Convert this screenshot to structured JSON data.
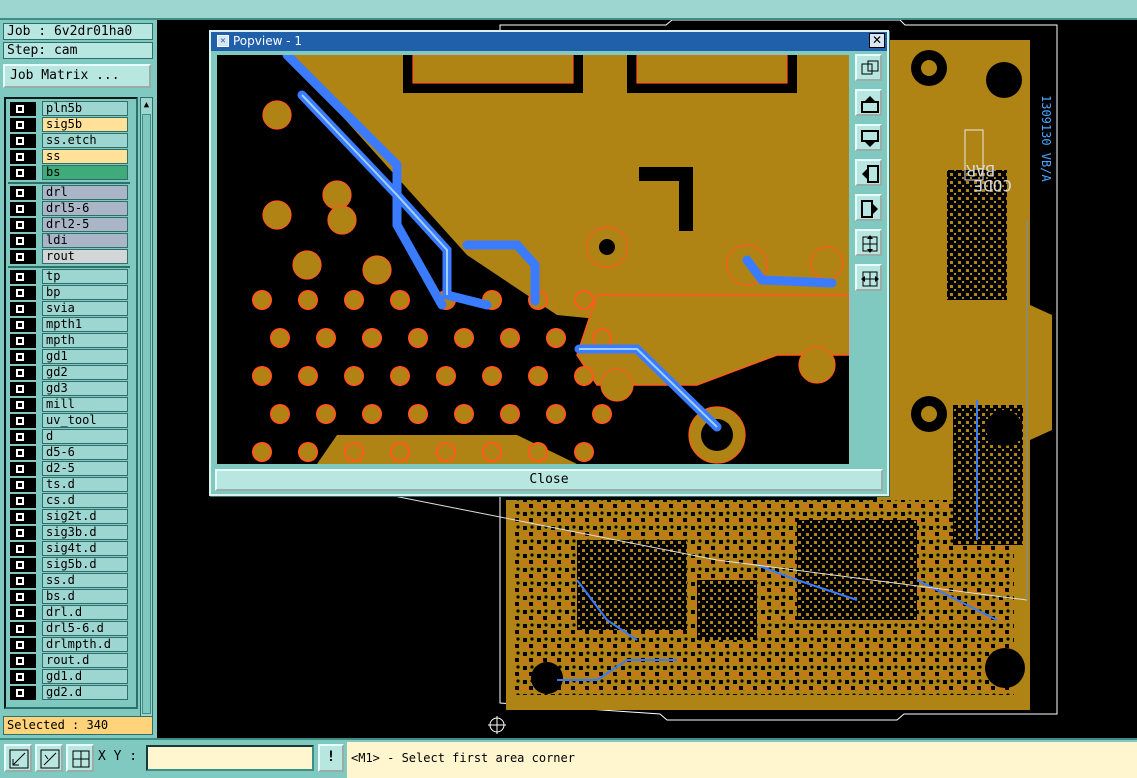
{
  "info": {
    "job_line": "Job : 6v2dr01ha0",
    "step_line": "Step: cam",
    "job_matrix_label": "Job Matrix ..."
  },
  "layers": [
    {
      "name": "pln5b",
      "style": "normal"
    },
    {
      "name": "sig5b",
      "style": "board"
    },
    {
      "name": "ss.etch",
      "style": "normal"
    },
    {
      "name": "ss",
      "style": "board",
      "active": true
    },
    {
      "name": "bs",
      "style": "bs"
    },
    {
      "name": "drl",
      "style": "drill"
    },
    {
      "name": "drl5-6",
      "style": "drill"
    },
    {
      "name": "drl2-5",
      "style": "drill"
    },
    {
      "name": "ldi",
      "style": "drill"
    },
    {
      "name": "rout",
      "style": "rout"
    },
    {
      "name": "tp",
      "style": "normal"
    },
    {
      "name": "bp",
      "style": "normal"
    },
    {
      "name": "svia",
      "style": "normal"
    },
    {
      "name": "mpth1",
      "style": "normal"
    },
    {
      "name": "mpth",
      "style": "normal"
    },
    {
      "name": "gd1",
      "style": "normal"
    },
    {
      "name": "gd2",
      "style": "normal"
    },
    {
      "name": "gd3",
      "style": "normal"
    },
    {
      "name": "mill",
      "style": "normal"
    },
    {
      "name": "uv_tool",
      "style": "normal"
    },
    {
      "name": "d",
      "style": "normal"
    },
    {
      "name": "d5-6",
      "style": "normal"
    },
    {
      "name": "d2-5",
      "style": "normal"
    },
    {
      "name": "ts.d",
      "style": "normal"
    },
    {
      "name": "cs.d",
      "style": "normal"
    },
    {
      "name": "sig2t.d",
      "style": "normal"
    },
    {
      "name": "sig3b.d",
      "style": "normal"
    },
    {
      "name": "sig4t.d",
      "style": "normal"
    },
    {
      "name": "sig5b.d",
      "style": "normal"
    },
    {
      "name": "ss.d",
      "style": "normal"
    },
    {
      "name": "bs.d",
      "style": "normal"
    },
    {
      "name": "drl.d",
      "style": "normal"
    },
    {
      "name": "drl5-6.d",
      "style": "normal"
    },
    {
      "name": "drlmpth.d",
      "style": "normal"
    },
    {
      "name": "rout.d",
      "style": "normal"
    },
    {
      "name": "gd1.d",
      "style": "normal"
    },
    {
      "name": "gd2.d",
      "style": "normal"
    }
  ],
  "selected_text": "Selected : 340",
  "popview": {
    "title": "Popview - 1",
    "close_label": "Close",
    "close_x": "✕"
  },
  "board": {
    "silk_text_1": "CODE",
    "silk_text_2": "BAR",
    "silk_text_3": "1309130 VB/A"
  },
  "bottom": {
    "xy_label": "X Y :",
    "xy_value": "",
    "warn_symbol": "!",
    "status_message": "<M1> - Select first area corner"
  },
  "colors": {
    "board": "#b08414",
    "copper_edge": "#ff5a1e",
    "trace": "#3a7bff",
    "panel": "#7fc9c0",
    "title_bar": "#205faa"
  }
}
